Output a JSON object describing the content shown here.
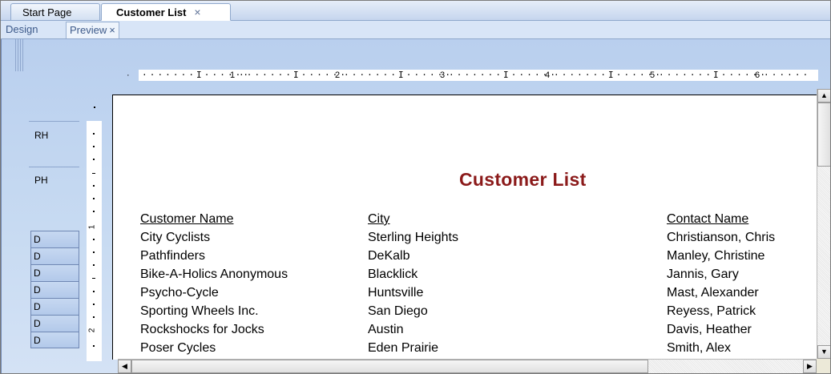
{
  "doc_tabs": {
    "start_page": "Start Page",
    "customer_list": "Customer List",
    "close_glyph": "×"
  },
  "view_tabs": {
    "design": "Design",
    "preview": "Preview",
    "close_glyph": "×"
  },
  "sections": {
    "report_header": "RH",
    "page_header": "PH",
    "detail": [
      "D",
      "D",
      "D",
      "D",
      "D",
      "D",
      "D"
    ]
  },
  "ruler": {
    "horizontal": [
      "1",
      "2",
      "3",
      "4",
      "5",
      "6"
    ],
    "vertical": [
      "1",
      "2"
    ]
  },
  "report": {
    "title": "Customer List",
    "columns": [
      "Customer Name",
      "City",
      "Contact Name"
    ],
    "rows": [
      [
        "City Cyclists",
        "Sterling Heights",
        "Christianson, Chris"
      ],
      [
        "Pathfinders",
        "DeKalb",
        "Manley, Christine"
      ],
      [
        "Bike-A-Holics Anonymous",
        "Blacklick",
        "Jannis, Gary"
      ],
      [
        "Psycho-Cycle",
        "Huntsville",
        "Mast, Alexander"
      ],
      [
        "Sporting Wheels Inc.",
        "San Diego",
        "Reyess, Patrick"
      ],
      [
        "Rockshocks for Jocks",
        "Austin",
        "Davis, Heather"
      ],
      [
        "Poser Cycles",
        "Eden Prairie",
        "Smith, Alex"
      ]
    ]
  },
  "colors": {
    "title": "#8b1a1a",
    "tab_border": "#8fa8cc"
  }
}
